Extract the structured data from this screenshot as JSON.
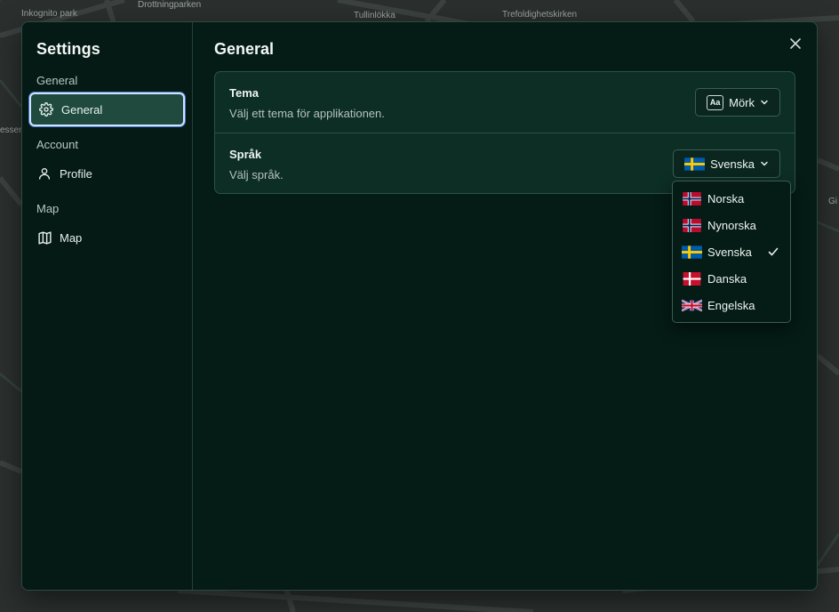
{
  "map": {
    "labels": [
      "Inkognito park",
      "Drottningparken",
      "Tullinlökka",
      "Trefoldighetskirken",
      "essen",
      "Gi"
    ]
  },
  "sidebar": {
    "title": "Settings",
    "groups": [
      {
        "label": "General",
        "items": [
          {
            "label": "General",
            "icon": "gear-icon",
            "active": true
          }
        ]
      },
      {
        "label": "Account",
        "items": [
          {
            "label": "Profile",
            "icon": "user-icon",
            "active": false
          }
        ]
      },
      {
        "label": "Map",
        "items": [
          {
            "label": "Map",
            "icon": "map-icon",
            "active": false
          }
        ]
      }
    ]
  },
  "main": {
    "title": "General",
    "close_icon": "close-icon",
    "settings": [
      {
        "label": "Tema",
        "description": "Välj ett tema för applikationen.",
        "value": "Mörk",
        "icon": "theme-aa-icon"
      },
      {
        "label": "Språk",
        "description": "Välj språk.",
        "value": "Svenska",
        "icon": "flag-se-icon"
      }
    ]
  },
  "language_dropdown": {
    "options": [
      {
        "label": "Norska",
        "flag": "no",
        "selected": false
      },
      {
        "label": "Nynorska",
        "flag": "no",
        "selected": false
      },
      {
        "label": "Svenska",
        "flag": "se",
        "selected": true
      },
      {
        "label": "Danska",
        "flag": "dk",
        "selected": false
      },
      {
        "label": "Engelska",
        "flag": "gb",
        "selected": false
      }
    ]
  },
  "colors": {
    "accent": "#1f4a3d",
    "focus_ring": "#cfe3ff",
    "panel": "#051b15",
    "card": "#0d2e25"
  }
}
